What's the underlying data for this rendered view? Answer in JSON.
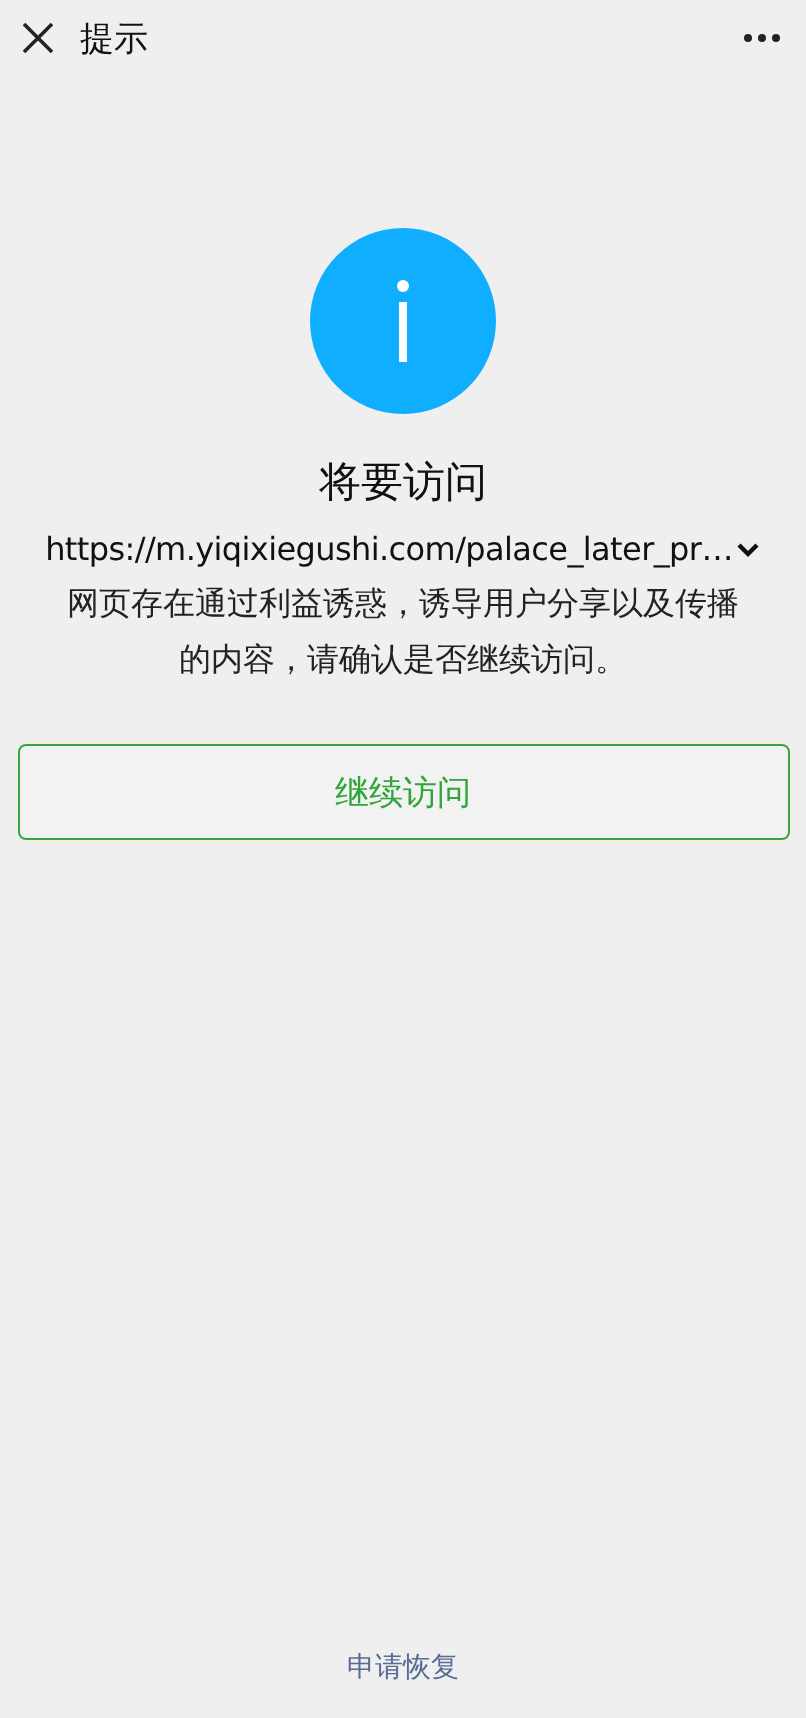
{
  "top_bar": {
    "title": "提示"
  },
  "notice": {
    "heading": "将要访问",
    "url": "https://m.yiqixiegushi.com/palace_later_pr…",
    "message": "网页存在通过利益诱惑，诱导用户分享以及传播的内容，请确认是否继续访问。"
  },
  "continue_button": {
    "label": "继续访问"
  },
  "footer_link": {
    "label": "申请恢复"
  }
}
